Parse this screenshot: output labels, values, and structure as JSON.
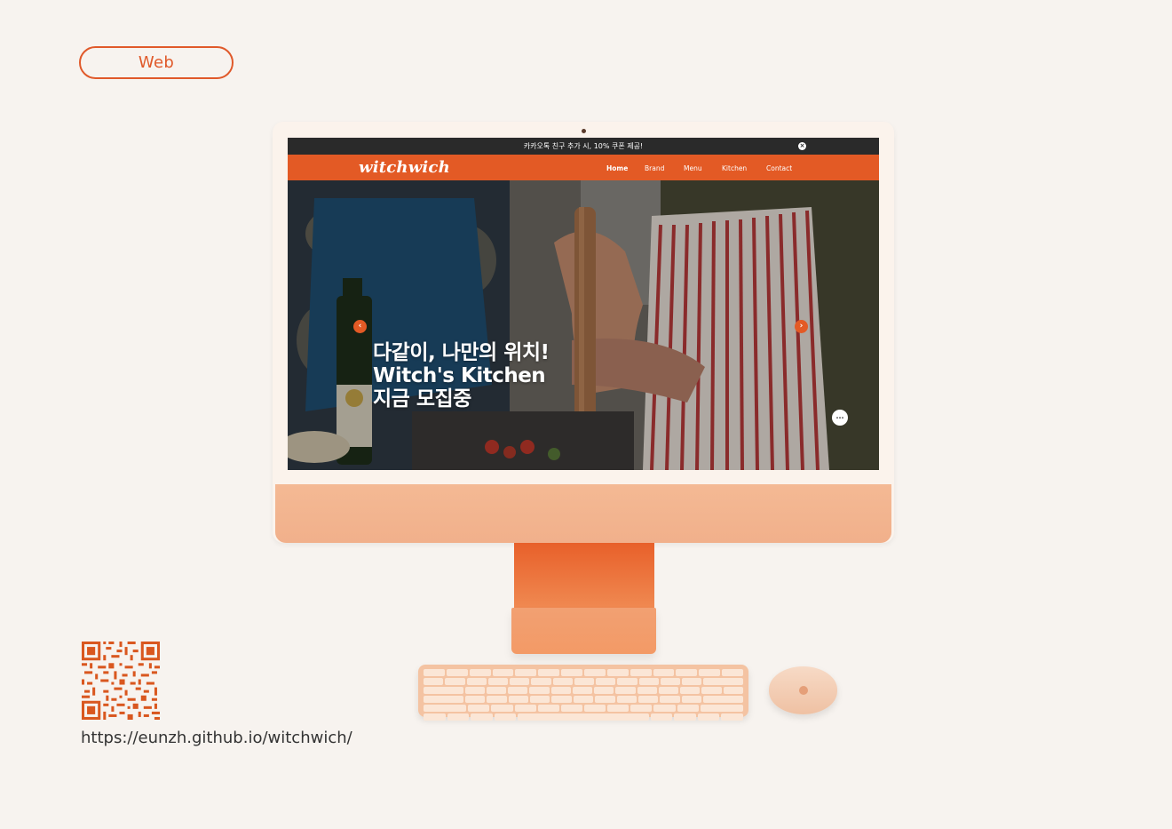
{
  "badge": {
    "label": "Web"
  },
  "website": {
    "announcement": "카카오톡 친구 추가 시, 10% 쿠폰 제공!",
    "announcement_close": "×",
    "logo": "witchwich",
    "nav": [
      {
        "label": "Home",
        "active": true
      },
      {
        "label": "Brand",
        "active": false
      },
      {
        "label": "Menu",
        "active": false
      },
      {
        "label": "Kitchen",
        "active": false
      },
      {
        "label": "Contact",
        "active": false
      }
    ],
    "hero": {
      "line1": "다같이, 나만의 위치!",
      "line2": "Witch's Kitchen",
      "line3": "지금 모집중"
    },
    "prev_arrow": "‹",
    "next_arrow": "›",
    "chat_icon": "…"
  },
  "qr": {
    "url": "https://eunzh.github.io/witchwich/"
  },
  "colors": {
    "accent": "#e35a25",
    "background": "#f7f3ef",
    "topbar": "#2a2a2a"
  }
}
